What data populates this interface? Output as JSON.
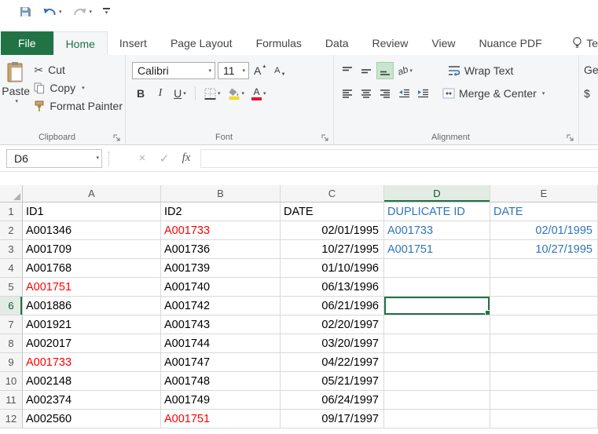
{
  "colors": {
    "accent": "#217346",
    "red": "#ff0000",
    "blue": "#2e75b6",
    "highlight": "#c9e4cf"
  },
  "ribbon_tabs": {
    "items": [
      "File",
      "Home",
      "Insert",
      "Page Layout",
      "Formulas",
      "Data",
      "Review",
      "View",
      "Nuance PDF"
    ],
    "active": "Home",
    "tell_me": "Te"
  },
  "clipboard": {
    "group": "Clipboard",
    "paste": "Paste",
    "cut": "Cut",
    "copy": "Copy",
    "format_painter": "Format Painter"
  },
  "font_group": {
    "group": "Font",
    "font_name": "Calibri",
    "font_size": "11",
    "bold": "B",
    "italic": "I",
    "underline": "U",
    "grow_letter": "A",
    "shrink_letter": "A",
    "color_letter": "A"
  },
  "alignment_group": {
    "group": "Alignment",
    "wrap_text": "Wrap Text",
    "merge_center": "Merge & Center",
    "orientation": "ab"
  },
  "number_group": {
    "partial_format": "Ge",
    "currency": "$"
  },
  "formula_bar": {
    "name_box": "D6",
    "fx": "fx",
    "formula": ""
  },
  "grid": {
    "columns": [
      "A",
      "B",
      "C",
      "D",
      "E"
    ],
    "rows": [
      {
        "n": 1,
        "cells": [
          {
            "t": "ID1"
          },
          {
            "t": "ID2"
          },
          {
            "t": "DATE"
          },
          {
            "t": "DUPLICATE ID",
            "c": "blue"
          },
          {
            "t": "DATE",
            "c": "blue"
          }
        ]
      },
      {
        "n": 2,
        "cells": [
          {
            "t": "A001346"
          },
          {
            "t": "A001733",
            "c": "red"
          },
          {
            "t": "02/01/1995",
            "a": "right"
          },
          {
            "t": "A001733",
            "c": "blue"
          },
          {
            "t": "02/01/1995",
            "c": "blue",
            "a": "right"
          }
        ]
      },
      {
        "n": 3,
        "cells": [
          {
            "t": "A001709"
          },
          {
            "t": "A001736"
          },
          {
            "t": "10/27/1995",
            "a": "right"
          },
          {
            "t": "A001751",
            "c": "blue"
          },
          {
            "t": "10/27/1995",
            "c": "blue",
            "a": "right"
          }
        ]
      },
      {
        "n": 4,
        "cells": [
          {
            "t": "A001768"
          },
          {
            "t": "A001739"
          },
          {
            "t": "01/10/1996",
            "a": "right"
          },
          {
            "t": ""
          },
          {
            "t": ""
          }
        ]
      },
      {
        "n": 5,
        "cells": [
          {
            "t": "A001751",
            "c": "red"
          },
          {
            "t": "A001740"
          },
          {
            "t": "06/13/1996",
            "a": "right"
          },
          {
            "t": ""
          },
          {
            "t": ""
          }
        ]
      },
      {
        "n": 6,
        "cells": [
          {
            "t": "A001886"
          },
          {
            "t": "A001742"
          },
          {
            "t": "06/21/1996",
            "a": "right"
          },
          {
            "t": ""
          },
          {
            "t": ""
          }
        ]
      },
      {
        "n": 7,
        "cells": [
          {
            "t": "A001921"
          },
          {
            "t": "A001743"
          },
          {
            "t": "02/20/1997",
            "a": "right"
          },
          {
            "t": ""
          },
          {
            "t": ""
          }
        ]
      },
      {
        "n": 8,
        "cells": [
          {
            "t": "A002017"
          },
          {
            "t": "A001744"
          },
          {
            "t": "03/20/1997",
            "a": "right"
          },
          {
            "t": ""
          },
          {
            "t": ""
          }
        ]
      },
      {
        "n": 9,
        "cells": [
          {
            "t": "A001733",
            "c": "red"
          },
          {
            "t": "A001747"
          },
          {
            "t": "04/22/1997",
            "a": "right"
          },
          {
            "t": ""
          },
          {
            "t": ""
          }
        ]
      },
      {
        "n": 10,
        "cells": [
          {
            "t": "A002148"
          },
          {
            "t": "A001748"
          },
          {
            "t": "05/21/1997",
            "a": "right"
          },
          {
            "t": ""
          },
          {
            "t": ""
          }
        ]
      },
      {
        "n": 11,
        "cells": [
          {
            "t": "A002374"
          },
          {
            "t": "A001749"
          },
          {
            "t": "06/24/1997",
            "a": "right"
          },
          {
            "t": ""
          },
          {
            "t": ""
          }
        ]
      },
      {
        "n": 12,
        "cells": [
          {
            "t": "A002560"
          },
          {
            "t": "A001751",
            "c": "red"
          },
          {
            "t": "09/17/1997",
            "a": "right"
          },
          {
            "t": ""
          },
          {
            "t": ""
          }
        ]
      }
    ]
  }
}
